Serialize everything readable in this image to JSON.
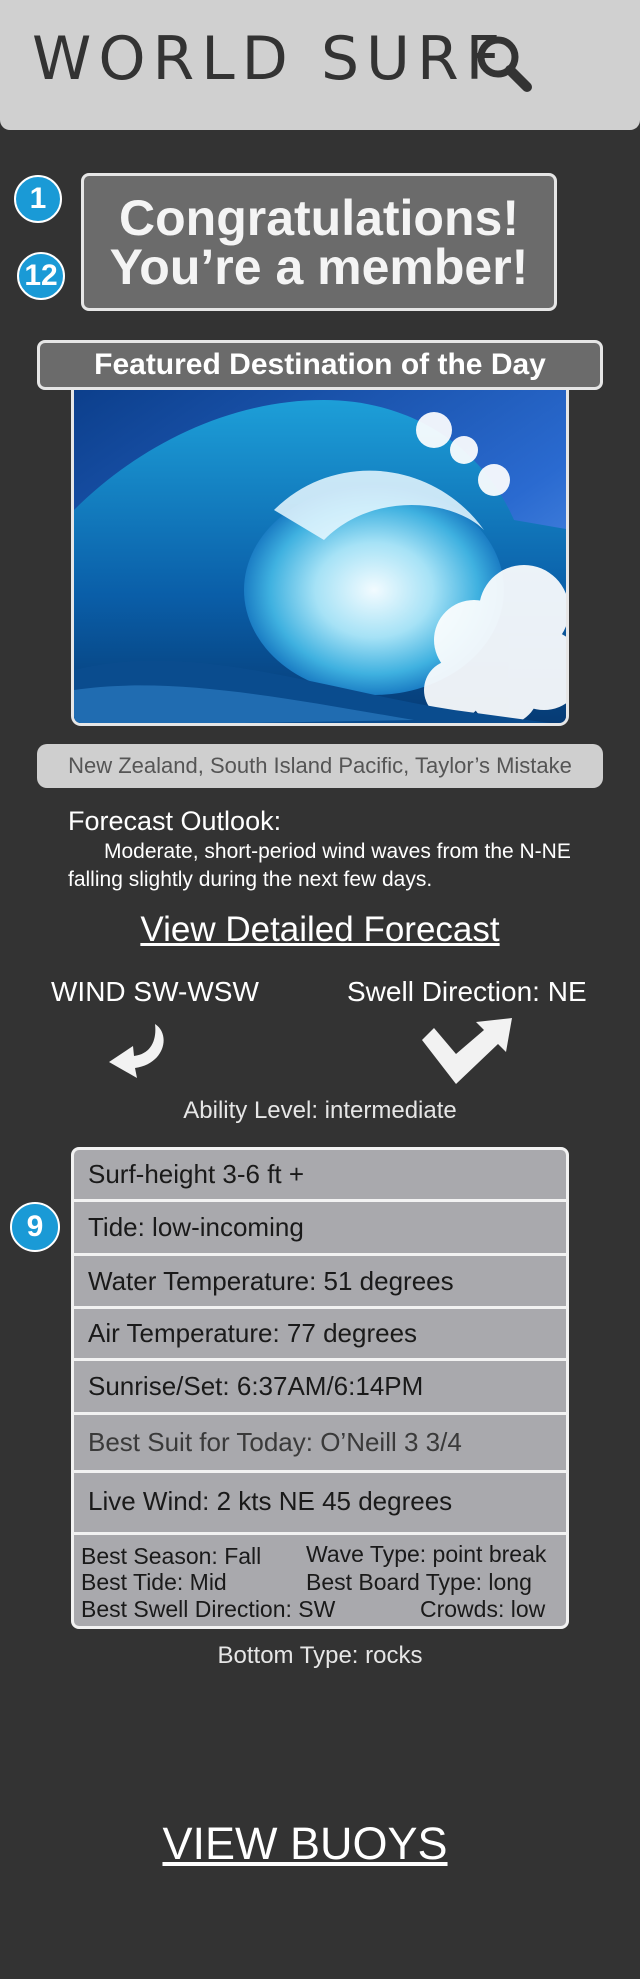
{
  "header": {
    "logo": "WORLD SURF",
    "search_icon": "search-icon"
  },
  "badges": [
    "1",
    "12",
    "9"
  ],
  "congrats": {
    "line1": "Congratulations!",
    "line2": "You’re a member!"
  },
  "featured": {
    "title": "Featured Destination of the Day",
    "image": "wave-image",
    "location": "New Zealand, South Island Pacific, Taylor’s Mistake"
  },
  "forecast": {
    "label": "Forecast Outlook:",
    "text": "Moderate, short-period wind waves from the N-NE falling slightly during the next few days.",
    "detail_link": "View Detailed Forecast"
  },
  "wind": {
    "label": "WIND SW-WSW",
    "icon": "curved-arrow-icon"
  },
  "swell": {
    "label": "Swell Direction: NE",
    "icon": "swell-arrow-icon"
  },
  "ability": "Ability Level: intermediate",
  "stats": {
    "rows": [
      "Surf-height 3-6 ft +",
      "Tide: low-incoming",
      "Water Temperature: 51 degrees",
      "Air Temperature: 77 degrees",
      "Sunrise/Set: 6:37AM/6:14PM",
      "Best Suit for Today: O’Neill 3 3/4",
      "Live Wind: 2 kts NE 45 degrees"
    ],
    "grid": {
      "best_season": "Best Season: Fall",
      "wave_type": "Wave Type: point break",
      "best_tide": "Best Tide: Mid",
      "board_type": "Best Board Type: long",
      "swell_direction": "Best Swell Direction: SW",
      "crowds": "Crowds: low"
    }
  },
  "bottom_type": "Bottom Type: rocks",
  "view_buoys": "VIEW BUOYS",
  "colors": {
    "background": "#333333",
    "header": "#d0d0d0",
    "badge": "#1a9ad6",
    "panel": "#6b6b6b",
    "stat_row": "#a9a9ad"
  }
}
